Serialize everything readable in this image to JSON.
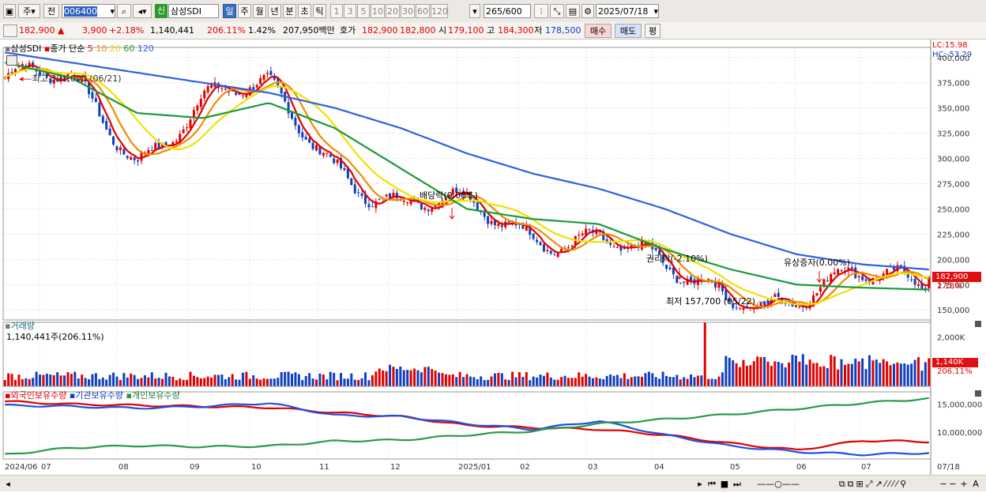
{
  "toolbar": {
    "mode1": "주",
    "mode2": "전",
    "code": "006400",
    "badge": "신",
    "stock_name": "삼성SDI",
    "periods": [
      "일",
      "주",
      "월",
      "년",
      "분",
      "초",
      "틱"
    ],
    "intervals": [
      "1",
      "3",
      "5",
      "10",
      "20",
      "30",
      "60",
      "120"
    ],
    "count": "265",
    "total": "/600",
    "date": "2025/07/18"
  },
  "info": {
    "price": "182,900",
    "change": "3,900",
    "change_pct": "+2.18%",
    "volume": "1,140,441",
    "volume_ratio": "206.11%",
    "turnover_pct": "1.42%",
    "amount": "207,950백만",
    "quote_label": "호가",
    "ask": "182,900",
    "bid": "182,800",
    "open_label": "시",
    "open": "179,100",
    "high_label": "고",
    "high": "184,300",
    "low_label": "저",
    "low": "178,500",
    "buy_button": "매수",
    "sell_button": "매도",
    "eval_button": "평"
  },
  "price_panel": {
    "legend_name": "삼성SDI",
    "legend_ma": "종가 단순",
    "ma_periods": [
      "5",
      "10",
      "20",
      "60",
      "120"
    ],
    "lc": "LC:15.98",
    "hc": "HC:-53.29",
    "current_price": "182,900",
    "current_pct": "2.18%",
    "annot_high": "최고 391,000 (06/21)",
    "annot_low": "최저 157,700 (05/22)",
    "annot_dividend": "배당락(0.00%)",
    "annot_rights": "권리락(-2.10%)",
    "annot_paidin": "유상증자(0.00%)"
  },
  "volume_panel": {
    "title": "거래량",
    "info": "1,140,441주(206.11%)",
    "current": "1,140K",
    "pct": "206.11%"
  },
  "holding_panel": {
    "legend": [
      "외국인보유수량",
      "기관보유수량",
      "개인보유수량"
    ]
  },
  "x_axis_labels": [
    "2024/06",
    "07",
    "08",
    "09",
    "10",
    "11",
    "12",
    "2025/01",
    "02",
    "03",
    "04",
    "05",
    "06",
    "07"
  ],
  "x_axis_right": "07/18",
  "colors": {
    "up": "#e00000",
    "down": "#1040c0",
    "ma5": "#e00000",
    "ma10": "#f08c00",
    "ma20": "#f0e000",
    "ma60": "#1a9a3a",
    "ma120": "#3060e0"
  },
  "chart_data": {
    "type": "line",
    "title": "",
    "x": [
      "2024/06",
      "07",
      "08",
      "09",
      "10",
      "11",
      "12",
      "2025/01",
      "02",
      "03",
      "04",
      "05",
      "06",
      "07",
      "07/18"
    ],
    "series": [
      {
        "name": "삼성SDI",
        "values": [
          380000,
          370000,
          305000,
          360000,
          360000,
          300000,
          255000,
          245000,
          230000,
          225000,
          180000,
          170000,
          162000,
          175000,
          182900
        ]
      },
      {
        "name": "60",
        "values": [
          395000,
          380000,
          345000,
          340000,
          355000,
          330000,
          290000,
          250000,
          240000,
          235000,
          210000,
          190000,
          175000,
          172000,
          170000
        ]
      },
      {
        "name": "120",
        "values": [
          405000,
          395000,
          385000,
          375000,
          365000,
          350000,
          330000,
          305000,
          285000,
          270000,
          250000,
          225000,
          205000,
          195000,
          190000
        ]
      }
    ],
    "ylim": [
      140000,
      410000
    ],
    "y_ticks": [
      "400,000",
      "375,000",
      "350,000",
      "325,000",
      "300,000",
      "275,000",
      "250,000",
      "225,000",
      "200,000",
      "175,000",
      "150,000"
    ],
    "volume_ticks": [
      "2,000K"
    ],
    "holding_ticks": [
      "15,000,000",
      "10,000,000"
    ],
    "holding_series": [
      {
        "name": "외국인보유수량",
        "values": [
          15500000,
          15000000,
          14800000,
          14600000,
          14400000,
          13500000,
          12800000,
          11200000,
          10800000,
          10500000,
          9500000,
          8000000,
          6800000,
          8500000,
          8300000
        ]
      },
      {
        "name": "기관보유수량",
        "values": [
          14800000,
          14600000,
          14300000,
          14600000,
          15200000,
          13000000,
          12800000,
          11500000,
          10500000,
          12000000,
          9500000,
          7500000,
          6500000,
          6000000,
          6300000
        ]
      },
      {
        "name": "개인보유수량",
        "values": [
          6000000,
          7200000,
          7600000,
          7400000,
          7500000,
          8400000,
          8600000,
          9500000,
          10200000,
          11500000,
          12300000,
          13200000,
          14200000,
          15200000,
          16000000
        ]
      }
    ]
  }
}
